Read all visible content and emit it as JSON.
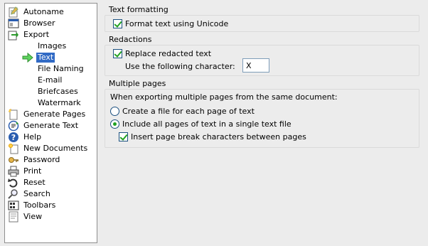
{
  "sidebar": {
    "items": [
      {
        "label": "Autoname",
        "icon": "autoname-icon"
      },
      {
        "label": "Browser",
        "icon": "browser-icon"
      },
      {
        "label": "Export",
        "icon": "export-icon"
      },
      {
        "label": "Images"
      },
      {
        "label": "Text",
        "selected": true,
        "icon": "arrow-right-icon"
      },
      {
        "label": "File Naming"
      },
      {
        "label": "E-mail"
      },
      {
        "label": "Briefcases"
      },
      {
        "label": "Watermark"
      },
      {
        "label": "Generate Pages",
        "icon": "generate-pages-icon"
      },
      {
        "label": "Generate Text",
        "icon": "generate-text-icon"
      },
      {
        "label": "Help",
        "icon": "help-icon"
      },
      {
        "label": "New Documents",
        "icon": "new-documents-icon"
      },
      {
        "label": "Password",
        "icon": "key-icon"
      },
      {
        "label": "Print",
        "icon": "printer-icon"
      },
      {
        "label": "Reset",
        "icon": "reset-icon"
      },
      {
        "label": "Search",
        "icon": "search-icon"
      },
      {
        "label": "Toolbars",
        "icon": "toolbars-icon"
      },
      {
        "label": "View",
        "icon": "view-icon"
      }
    ]
  },
  "text_formatting": {
    "title": "Text formatting",
    "unicode_label": "Format text using Unicode",
    "unicode_checked": true
  },
  "redactions": {
    "title": "Redactions",
    "replace_label": "Replace redacted text",
    "replace_checked": true,
    "char_label": "Use the following character:",
    "char_value": "X"
  },
  "multiple_pages": {
    "title": "Multiple pages",
    "description": "When exporting multiple pages from the same document:",
    "option_each_label": "Create a file for each page of text",
    "option_each_selected": false,
    "option_single_label": "Include all pages of text in a single text file",
    "option_single_selected": true,
    "page_break_label": "Insert page break characters between pages",
    "page_break_checked": true
  },
  "colors": {
    "selection": "#316ac5",
    "check": "#21a121"
  }
}
